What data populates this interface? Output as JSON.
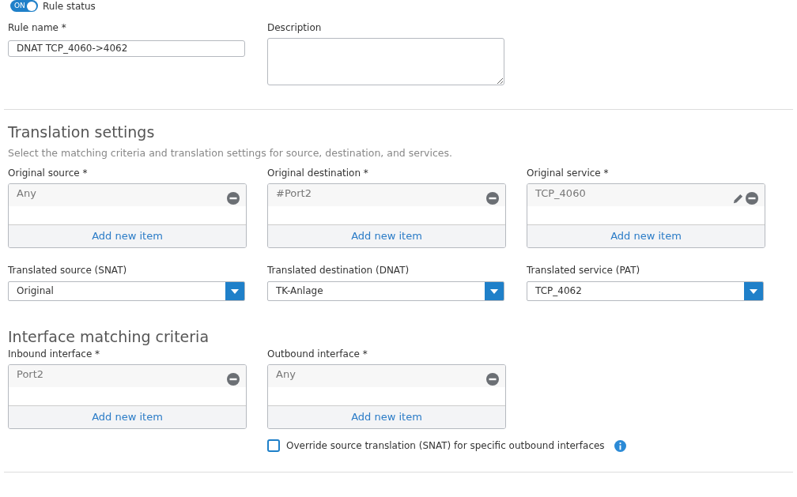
{
  "rule_status": {
    "toggle_text": "ON",
    "on": true,
    "label": "Rule status"
  },
  "rule_name": {
    "label": "Rule name *",
    "value": "DNAT TCP_4060->4062"
  },
  "description": {
    "label": "Description"
  },
  "translation": {
    "heading": "Translation settings",
    "subtitle": "Select the matching criteria and translation settings for source, destination, and services.",
    "lists": [
      {
        "label": "Original source *",
        "items": [
          {
            "text": "Any",
            "editable": false
          }
        ],
        "add_text": "Add new item"
      },
      {
        "label": "Original destination *",
        "items": [
          {
            "text": "#Port2",
            "editable": false
          }
        ],
        "add_text": "Add new item"
      },
      {
        "label": "Original service *",
        "items": [
          {
            "text": "TCP_4060",
            "editable": true
          }
        ],
        "add_text": "Add new item"
      }
    ],
    "selects": [
      {
        "label": "Translated source (SNAT)",
        "value": "Original"
      },
      {
        "label": "Translated destination (DNAT)",
        "value": "TK-Anlage"
      },
      {
        "label": "Translated service (PAT)",
        "value": "TCP_4062"
      }
    ]
  },
  "interface": {
    "heading": "Interface matching criteria",
    "lists": [
      {
        "label": "Inbound interface *",
        "items": [
          {
            "text": "Port2",
            "editable": false
          }
        ],
        "add_text": "Add new item"
      },
      {
        "label": "Outbound interface *",
        "items": [
          {
            "text": "Any",
            "editable": false
          }
        ],
        "add_text": "Add new item"
      }
    ],
    "override": {
      "label": "Override source translation (SNAT) for specific outbound interfaces",
      "checked": false
    }
  }
}
